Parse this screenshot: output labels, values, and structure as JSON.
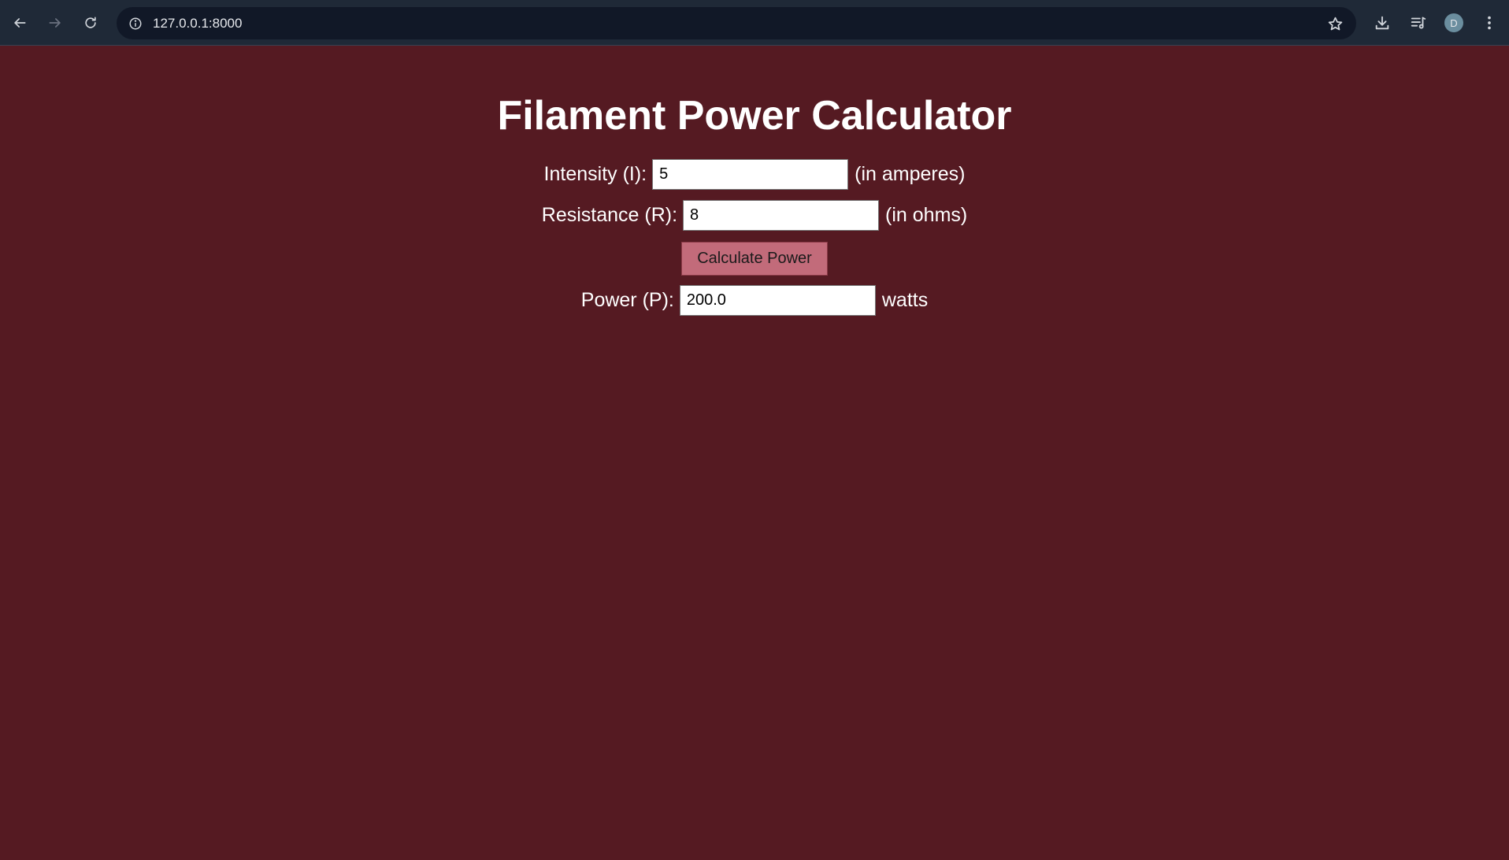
{
  "browser": {
    "url": "127.0.0.1:8000",
    "profile_initial": "D",
    "icons": {
      "back": "arrow-left-icon",
      "forward": "arrow-right-icon",
      "reload": "reload-icon",
      "site_info": "info-icon",
      "bookmark": "star-icon",
      "download": "download-icon",
      "media": "media-queue-icon",
      "menu": "kebab-menu-icon"
    }
  },
  "page": {
    "title": "Filament Power Calculator",
    "background_color": "#551a22",
    "intensity": {
      "label": "Intensity (I):",
      "value": "5",
      "unit": "(in amperes)"
    },
    "resistance": {
      "label": "Resistance (R):",
      "value": "8",
      "unit": "(in ohms)"
    },
    "calculate_button": {
      "label": "Calculate Power",
      "color": "#c26b7a"
    },
    "power": {
      "label": "Power (P):",
      "value": "200.0",
      "unit": "watts"
    }
  }
}
